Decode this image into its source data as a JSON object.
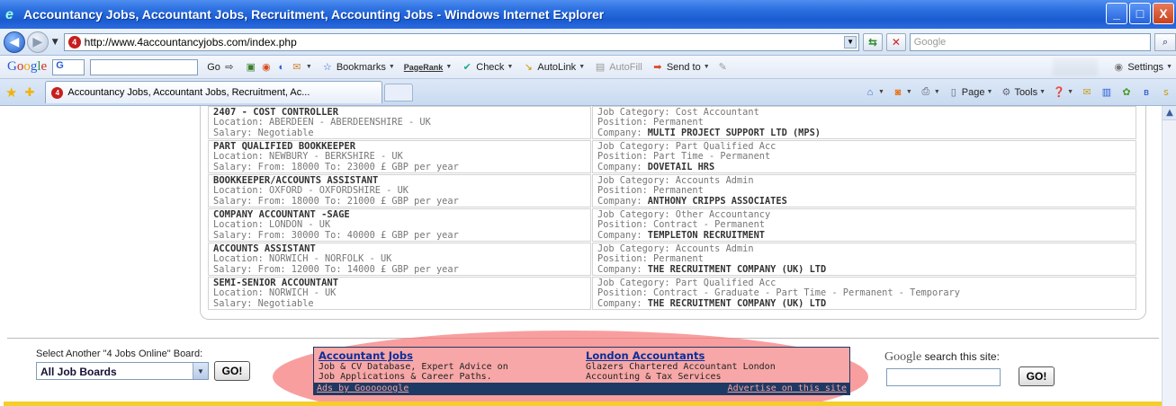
{
  "window": {
    "title": "Accountancy Jobs, Accountant Jobs, Recruitment, Accounting Jobs - Windows Internet Explorer",
    "min": "_",
    "max": "□",
    "close": "X"
  },
  "address": {
    "url": "http://www.4accountancyjobs.com/index.php",
    "search_placeholder": "Google"
  },
  "google_toolbar": {
    "logo_parts": [
      "G",
      "o",
      "o",
      "g",
      "l",
      "e"
    ],
    "box_text": "G",
    "go_label": "Go",
    "bookmarks": "Bookmarks",
    "pagerank": "PageRank",
    "check": "Check",
    "autolink": "AutoLink",
    "autofill": "AutoFill",
    "sendto": "Send to",
    "settings": "Settings"
  },
  "tab": {
    "label": "Accountancy Jobs, Accountant Jobs, Recruitment, Ac..."
  },
  "command_bar": {
    "page": "Page",
    "tools": "Tools"
  },
  "jobs": [
    {
      "title": "2407 - COST CONTROLLER",
      "location": "Location: ABERDEEN - ABERDEENSHIRE - UK",
      "salary": "Salary:  Negotiable",
      "category": "Job Category: Cost Accountant",
      "position": "Position: Permanent",
      "company_prefix": "Company: ",
      "company": "MULTI PROJECT SUPPORT LTD (MPS)"
    },
    {
      "title": "PART QUALIFIED BOOKKEEPER",
      "location": "Location: NEWBURY - BERKSHIRE - UK",
      "salary": "Salary: From: 18000 To: 23000 £ GBP per year",
      "category": "Job Category: Part Qualified Acc",
      "position": "Position: Part Time - Permanent",
      "company_prefix": "Company: ",
      "company": "DOVETAIL HRS"
    },
    {
      "title": "BOOKKEEPER/ACCOUNTS ASSISTANT",
      "location": "Location: OXFORD - OXFORDSHIRE - UK",
      "salary": "Salary: From: 18000 To: 21000 £ GBP per year",
      "category": "Job Category: Accounts Admin",
      "position": "Position: Permanent",
      "company_prefix": "Company: ",
      "company": "ANTHONY CRIPPS ASSOCIATES"
    },
    {
      "title": "COMPANY ACCOUNTANT -SAGE",
      "location": "Location: LONDON - UK",
      "salary": "Salary: From: 30000 To: 40000 £ GBP per year",
      "category": "Job Category: Other Accountancy",
      "position": "Position: Contract - Permanent",
      "company_prefix": "Company: ",
      "company": "TEMPLETON RECRUITMENT"
    },
    {
      "title": "ACCOUNTS ASSISTANT",
      "location": "Location: NORWICH - NORFOLK - UK",
      "salary": "Salary: From: 12000 To: 14000 £ GBP per year",
      "category": "Job Category: Accounts Admin",
      "position": "Position: Permanent",
      "company_prefix": "Company: ",
      "company": "THE RECRUITMENT COMPANY (UK) LTD"
    },
    {
      "title": "SEMI-SENIOR ACCOUNTANT",
      "location": "Location: NORWICH - UK",
      "salary": "Salary:  Negotiable",
      "category": "Job Category: Part Qualified Acc",
      "position": "Position: Contract - Graduate - Part Time - Permanent - Temporary",
      "company_prefix": "Company: ",
      "company": "THE RECRUITMENT COMPANY (UK) LTD"
    }
  ],
  "footer": {
    "board_label": "Select Another \"4 Jobs Online\" Board:",
    "board_selected": "All Job Boards",
    "go": "GO!",
    "google_label": "Google",
    "search_site": " search this site:",
    "site_go": "GO!"
  },
  "ads": {
    "ad1_title": "Accountant Jobs",
    "ad1_line1": "Job & CV Database, Expert Advice on",
    "ad1_line2": "Job Applications & Career Paths.",
    "ad2_title": "London Accountants",
    "ad2_line1": "Glazers Chartered Accountant London",
    "ad2_line2": "Accounting & Tax Services",
    "ads_by": "Ads by Goooooogle",
    "advertise": "Advertise on this site"
  },
  "colors": {
    "highlight_ellipse": "#f77878",
    "ad_footer": "#1d3a64",
    "bottom_bar": "#f4ce2a"
  }
}
